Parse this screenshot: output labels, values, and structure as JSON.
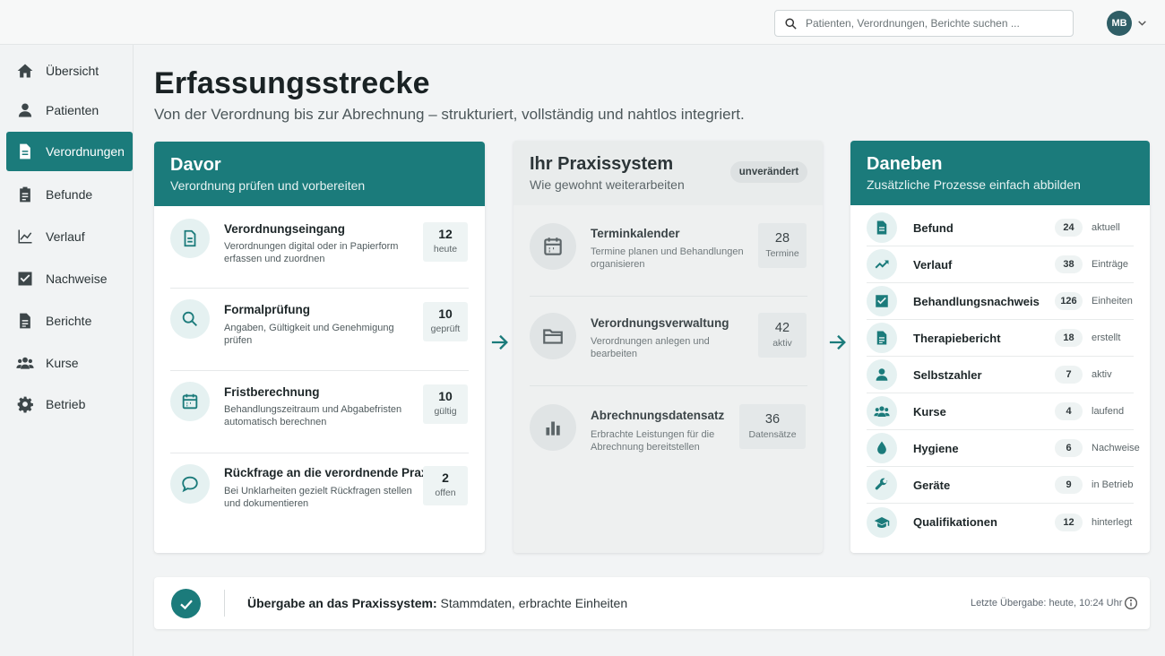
{
  "search": {
    "placeholder": "Patienten, Verordnungen, Berichte suchen ..."
  },
  "user": {
    "initials": "MB"
  },
  "sidebar": {
    "items": [
      {
        "label": "Übersicht",
        "icon": "home-icon"
      },
      {
        "label": "Patienten",
        "icon": "person-icon"
      },
      {
        "label": "Verordnungen",
        "icon": "document-icon",
        "active": true
      },
      {
        "label": "Befunde",
        "icon": "clipboard-icon"
      },
      {
        "label": "Verlauf",
        "icon": "chart-line-icon"
      },
      {
        "label": "Nachweise",
        "icon": "checkbox-icon"
      },
      {
        "label": "Berichte",
        "icon": "report-icon"
      },
      {
        "label": "Kurse",
        "icon": "group-icon"
      },
      {
        "label": "Betrieb",
        "icon": "gear-icon"
      }
    ]
  },
  "page": {
    "title": "Erfassungsstrecke",
    "subtitle": "Von der Verordnung bis zur Abrechnung – strukturiert, vollständig und nahtlos integriert."
  },
  "davor": {
    "title": "Davor",
    "subtitle": "Verordnung prüfen und vorbereiten",
    "rows": [
      {
        "title": "Verordnungseingang",
        "desc": "Verordnungen digital oder in Papierform erfassen und zuordnen",
        "value": "12",
        "unit": "heute",
        "icon": "document-icon"
      },
      {
        "title": "Formalprüfung",
        "desc": "Angaben, Gültigkeit und Genehmigung prüfen",
        "value": "10",
        "unit": "geprüft",
        "icon": "search-icon"
      },
      {
        "title": "Fristberechnung",
        "desc": "Behandlungszeitraum und Abgabefristen automatisch berechnen",
        "value": "10",
        "unit": "gültig",
        "icon": "calendar-icon"
      },
      {
        "title": "Rückfrage an die verordnende Praxis",
        "desc": "Bei Unklarheiten gezielt Rückfragen stellen und dokumentieren",
        "value": "2",
        "unit": "offen",
        "icon": "chat-icon"
      }
    ]
  },
  "praxis": {
    "title": "Ihr Praxissystem",
    "subtitle": "Wie gewohnt weiterarbeiten",
    "badge": "unverändert",
    "rows": [
      {
        "title": "Terminkalender",
        "desc": "Termine planen und Behandlungen organisieren",
        "value": "28",
        "unit": "Termine",
        "icon": "calendar-icon"
      },
      {
        "title": "Verordnungsverwaltung",
        "desc": "Verordnungen anlegen und bearbeiten",
        "value": "42",
        "unit": "aktiv",
        "icon": "folder-icon"
      },
      {
        "title": "Abrechnungsdatensatz",
        "desc": "Erbrachte Leistungen für die Abrechnung bereitstellen",
        "value": "36",
        "unit": "Datensätze",
        "icon": "bar-chart-icon"
      }
    ]
  },
  "daneben": {
    "title": "Daneben",
    "subtitle": "Zusätzliche Prozesse einfach abbilden",
    "rows": [
      {
        "label": "Befund",
        "count": "24",
        "unit": "aktuell",
        "icon": "document-icon"
      },
      {
        "label": "Verlauf",
        "count": "38",
        "unit": "Einträge",
        "icon": "trend-icon"
      },
      {
        "label": "Behandlungsnachweis",
        "count": "126",
        "unit": "Einheiten",
        "icon": "checkbox-icon"
      },
      {
        "label": "Therapiebericht",
        "count": "18",
        "unit": "erstellt",
        "icon": "report-icon"
      },
      {
        "label": "Selbstzahler",
        "count": "7",
        "unit": "aktiv",
        "icon": "person-icon"
      },
      {
        "label": "Kurse",
        "count": "4",
        "unit": "laufend",
        "icon": "group-icon"
      },
      {
        "label": "Hygiene",
        "count": "6",
        "unit": "Nachweise",
        "icon": "drop-icon"
      },
      {
        "label": "Geräte",
        "count": "9",
        "unit": "in Betrieb",
        "icon": "wrench-icon"
      },
      {
        "label": "Qualifikationen",
        "count": "12",
        "unit": "hinterlegt",
        "icon": "graduation-cap-icon"
      }
    ]
  },
  "handover": {
    "label": "Übergabe an das Praxissystem:",
    "text": "Stammdaten, erbrachte Einheiten",
    "last": "Letzte Übergabe: heute, 10:24 Uhr"
  },
  "colors": {
    "accent": "#1b7b7b",
    "accent_light": "#e5f1f1"
  }
}
